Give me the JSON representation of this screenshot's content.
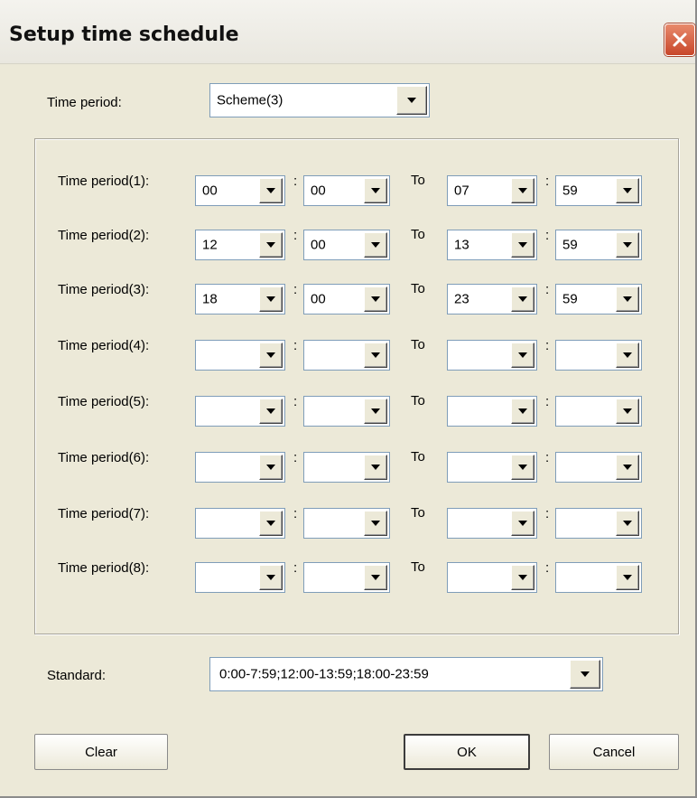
{
  "window": {
    "title": "Setup time schedule"
  },
  "time_period": {
    "label": "Time period:",
    "value": "Scheme(3)"
  },
  "separator": ":",
  "to_label": "To",
  "periods": [
    {
      "label": "Time period(1):",
      "start_hour": "00",
      "start_min": "00",
      "end_hour": "07",
      "end_min": "59"
    },
    {
      "label": "Time period(2):",
      "start_hour": "12",
      "start_min": "00",
      "end_hour": "13",
      "end_min": "59"
    },
    {
      "label": "Time period(3):",
      "start_hour": "18",
      "start_min": "00",
      "end_hour": "23",
      "end_min": "59"
    },
    {
      "label": "Time period(4):",
      "start_hour": "",
      "start_min": "",
      "end_hour": "",
      "end_min": ""
    },
    {
      "label": "Time period(5):",
      "start_hour": "",
      "start_min": "",
      "end_hour": "",
      "end_min": ""
    },
    {
      "label": "Time period(6):",
      "start_hour": "",
      "start_min": "",
      "end_hour": "",
      "end_min": ""
    },
    {
      "label": "Time period(7):",
      "start_hour": "",
      "start_min": "",
      "end_hour": "",
      "end_min": ""
    },
    {
      "label": "Time period(8):",
      "start_hour": "",
      "start_min": "",
      "end_hour": "",
      "end_min": ""
    }
  ],
  "standard": {
    "label": "Standard:",
    "value": "0:00-7:59;12:00-13:59;18:00-23:59"
  },
  "buttons": {
    "clear": "Clear",
    "ok": "OK",
    "cancel": "Cancel"
  },
  "icons": {
    "close": "close-icon",
    "dropdown": "chevron-down-icon"
  },
  "colors": {
    "close_button": "#c8462a",
    "dialog_bg": "#ece9d8",
    "field_border": "#7f9db9"
  }
}
